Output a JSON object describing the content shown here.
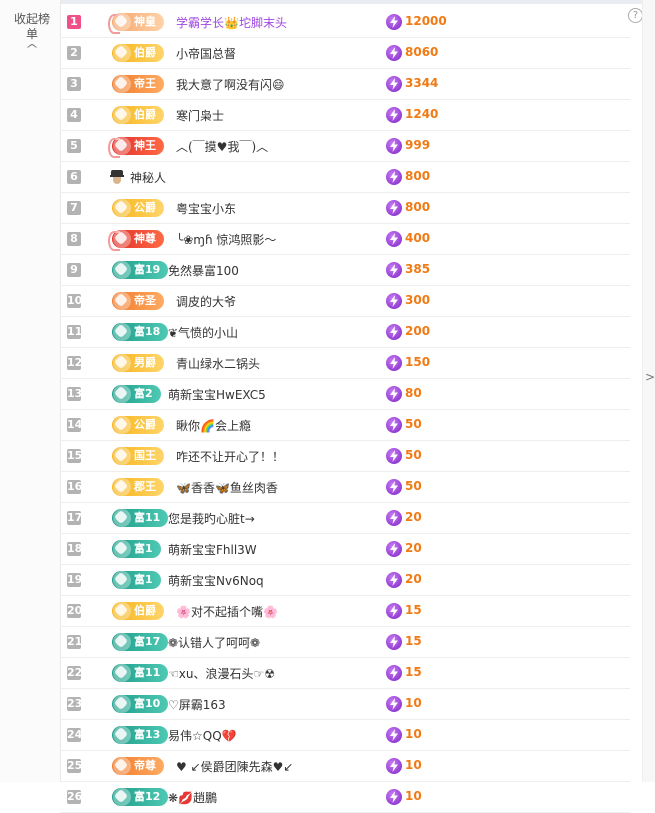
{
  "panel": {
    "collapse_label": "收起榜单",
    "collapse_chevron": "^",
    "help_icon_text": "?",
    "right_arrow": ">"
  },
  "rows": [
    {
      "rank": "1",
      "badge": "神皇",
      "badge_style": "pink",
      "name": "学霸学长👑坨脚末头",
      "score": "12000"
    },
    {
      "rank": "2",
      "badge": "伯爵",
      "badge_style": "gold",
      "name": "小帝国总督",
      "score": "8060"
    },
    {
      "rank": "3",
      "badge": "帝王",
      "badge_style": "orange",
      "name": "我大意了啊没有闪😄",
      "score": "3344"
    },
    {
      "rank": "4",
      "badge": "伯爵",
      "badge_style": "gold",
      "name": "寒门枭士",
      "score": "1240"
    },
    {
      "rank": "5",
      "badge": "神王",
      "badge_style": "red",
      "name": "︿(￣摸♥我￣)︿",
      "score": "999"
    },
    {
      "rank": "6",
      "badge": "",
      "badge_style": "mystery",
      "name": "神秘人",
      "score": "800"
    },
    {
      "rank": "7",
      "badge": "公爵",
      "badge_style": "gold",
      "name": "粤宝宝小东",
      "score": "800"
    },
    {
      "rank": "8",
      "badge": "神尊",
      "badge_style": "red",
      "name": "╰❀ɱɦ 惊鸿照影～",
      "score": "400"
    },
    {
      "rank": "9",
      "badge": "富19",
      "badge_style": "teal",
      "name": "免然暴富100",
      "score": "385"
    },
    {
      "rank": "10",
      "badge": "帝圣",
      "badge_style": "orange",
      "name": "调皮的大爷",
      "score": "300"
    },
    {
      "rank": "11",
      "badge": "富18",
      "badge_style": "teal",
      "name": "❦气愤的小山",
      "score": "200"
    },
    {
      "rank": "12",
      "badge": "男爵",
      "badge_style": "gold",
      "name": "青山绿水二锅头",
      "score": "150"
    },
    {
      "rank": "13",
      "badge": "富2",
      "badge_style": "teal",
      "name": "萌新宝宝HwEXC5",
      "score": "80"
    },
    {
      "rank": "14",
      "badge": "公爵",
      "badge_style": "gold",
      "name": "瞅你🌈会上瘾",
      "score": "50"
    },
    {
      "rank": "15",
      "badge": "国王",
      "badge_style": "gold",
      "name": "咋还不让开心了！！",
      "score": "50"
    },
    {
      "rank": "16",
      "badge": "郡王",
      "badge_style": "gold",
      "name": "🦋香香🦋鱼丝肉香",
      "score": "50"
    },
    {
      "rank": "17",
      "badge": "富11",
      "badge_style": "teal",
      "name": "您是莪旳心脏t→",
      "score": "20"
    },
    {
      "rank": "18",
      "badge": "富1",
      "badge_style": "teal",
      "name": "萌新宝宝Fhll3W",
      "score": "20"
    },
    {
      "rank": "19",
      "badge": "富1",
      "badge_style": "teal",
      "name": "萌新宝宝Nv6Noq",
      "score": "20"
    },
    {
      "rank": "20",
      "badge": "伯爵",
      "badge_style": "gold",
      "name": "🌸对不起插个嘴🌸",
      "score": "15"
    },
    {
      "rank": "21",
      "badge": "富17",
      "badge_style": "teal",
      "name": "❁认错人了呵呵❁",
      "score": "15"
    },
    {
      "rank": "22",
      "badge": "富11",
      "badge_style": "teal",
      "name": "☜xu、浪漫石头☞☢",
      "score": "15"
    },
    {
      "rank": "23",
      "badge": "富10",
      "badge_style": "teal",
      "name": "♡屏霸163",
      "score": "10"
    },
    {
      "rank": "24",
      "badge": "富13",
      "badge_style": "teal",
      "name": "易伟☆QQ💔",
      "score": "10"
    },
    {
      "rank": "25",
      "badge": "帝尊",
      "badge_style": "orange",
      "name": "♥ ↙侯爵团陳先森♥↙",
      "score": "10"
    },
    {
      "rank": "26",
      "badge": "富12",
      "badge_style": "teal",
      "name": "❋💋趙鵬",
      "score": "10"
    }
  ],
  "colors": {
    "rank_first": "#f0508a",
    "rank_default": "#b3b3b3",
    "score": "#f07a14",
    "energy_icon": "#7d24c6"
  },
  "icons": {
    "score": "energy-bolt-icon",
    "help": "question-circle-icon",
    "collapse": "chevron-up-icon"
  }
}
